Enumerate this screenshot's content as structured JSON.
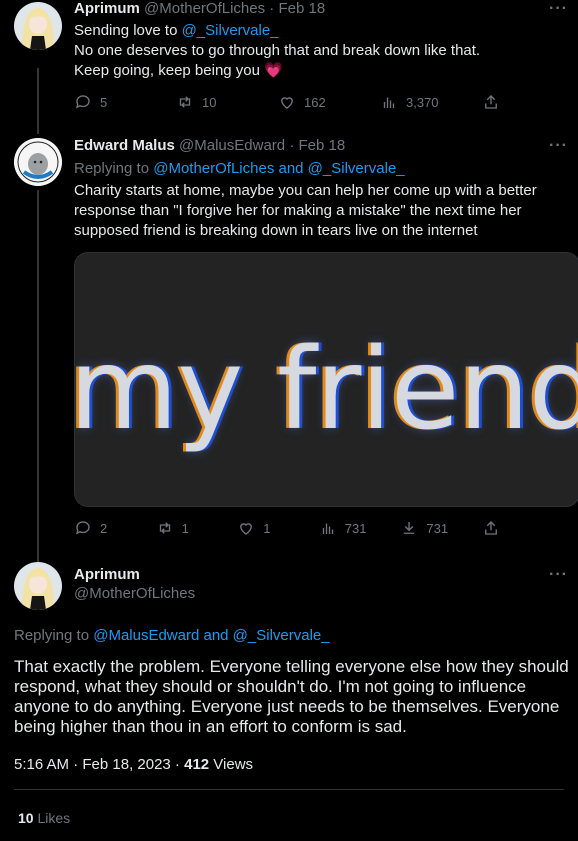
{
  "tweet1": {
    "name": "Aprimum",
    "handle": "@MotherOfLiches",
    "date": "Feb 18",
    "line1_prefix": "Sending love to ",
    "line1_mention": "@_Silvervale_",
    "line2": "No one deserves to go through that and break down like that.",
    "line3": "Keep going, keep being you",
    "emoji": "💗",
    "replies": "5",
    "retweets": "10",
    "likes": "162",
    "views": "3,370"
  },
  "tweet2": {
    "name": "Edward Malus",
    "handle": "@MalusEdward",
    "date": "Feb 18",
    "replying_prefix": "Replying to ",
    "replying_mentions": "@MotherOfLiches and @_Silvervale_",
    "body": "Charity starts at home, maybe you can help her come up with a better response than \"I forgive her for making a mistake\" the next time her supposed friend is breaking down in tears live on the internet",
    "media_text": "my friend",
    "replies": "2",
    "retweets": "1",
    "likes": "1",
    "views": "731",
    "bookmarks": "731"
  },
  "main_tweet": {
    "name": "Aprimum",
    "handle": "@MotherOfLiches",
    "replying_prefix": "Replying to ",
    "replying_mentions": "@MalusEdward and @_Silvervale_",
    "body": "That exactly the problem.  Everyone telling everyone else how they should respond,  what they should or shouldn't do. I'm not going to influence anyone to do anything.  Everyone just needs to be themselves. Everyone being higher than thou in an effort to conform is sad.",
    "time": "5:16 AM · Feb 18, 2023 · ",
    "views_count": "412",
    "views_label": " Views",
    "likes_count": "10",
    "likes_label": " Likes"
  },
  "icons": [
    "reply-icon",
    "retweet-icon",
    "like-icon",
    "views-icon",
    "share-icon",
    "bookmark-icon",
    "more-icon"
  ],
  "colors": {
    "background": "#000000",
    "text": "#e7e9ea",
    "muted": "#71767b",
    "link": "#1d9bf0",
    "heart": "#f91880"
  }
}
